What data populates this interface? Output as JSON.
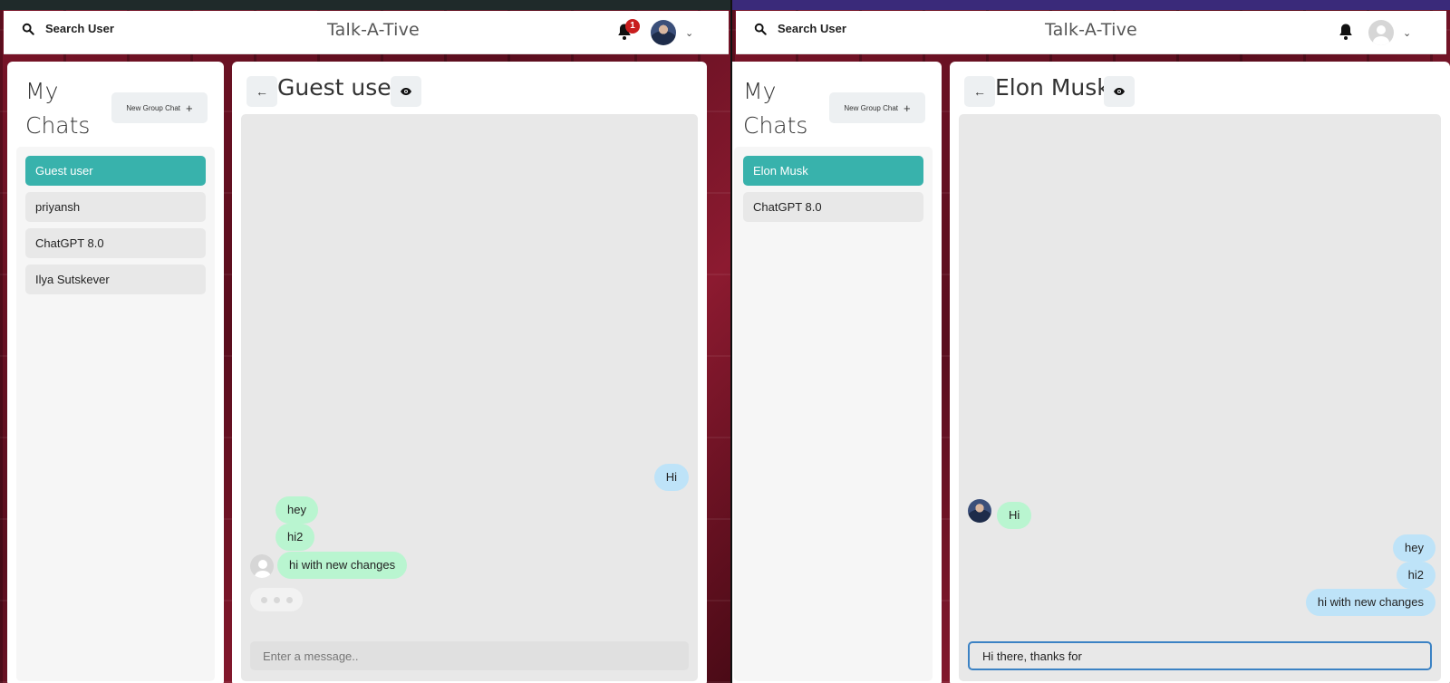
{
  "left": {
    "header": {
      "search_label": "Search User",
      "brand": "Talk-A-Tive",
      "notification_count": "1"
    },
    "sidebar": {
      "title": "My Chats",
      "new_group_label": "New Group Chat",
      "chats": [
        {
          "name": "Guest user",
          "active": true
        },
        {
          "name": "priyansh",
          "active": false
        },
        {
          "name": "ChatGPT 8.0",
          "active": false
        },
        {
          "name": "Ilya Sutskever",
          "active": false
        }
      ]
    },
    "chat": {
      "title": "Guest user",
      "messages": [
        {
          "text": "Hi",
          "direction": "outgoing"
        },
        {
          "text": "hey",
          "direction": "incoming"
        },
        {
          "text": "hi2",
          "direction": "incoming"
        },
        {
          "text": "hi with new changes",
          "direction": "incoming"
        }
      ],
      "typing_indicator": true,
      "input": {
        "placeholder": "Enter a message..",
        "value": ""
      }
    }
  },
  "right": {
    "header": {
      "search_label": "Search User",
      "brand": "Talk-A-Tive"
    },
    "sidebar": {
      "title": "My Chats",
      "new_group_label": "New Group Chat",
      "chats": [
        {
          "name": "Elon Musk",
          "active": true
        },
        {
          "name": "ChatGPT 8.0",
          "active": false
        }
      ]
    },
    "chat": {
      "title": "Elon Musk",
      "messages": [
        {
          "text": "Hi",
          "direction": "incoming"
        },
        {
          "text": "hey",
          "direction": "outgoing"
        },
        {
          "text": "hi2",
          "direction": "outgoing"
        },
        {
          "text": "hi with new changes",
          "direction": "outgoing"
        }
      ],
      "input": {
        "placeholder": "",
        "value": "Hi there, thanks for"
      }
    }
  },
  "colors": {
    "active_chat": "#38b2ac",
    "incoming_bubble": "#b9f5d0",
    "outgoing_bubble": "#bee3f8",
    "badge": "#c81e1e"
  },
  "icons": [
    "search-icon",
    "bell-icon",
    "chevron-down-icon",
    "plus-icon",
    "arrow-left-icon",
    "eye-icon",
    "user-avatar-icon"
  ]
}
